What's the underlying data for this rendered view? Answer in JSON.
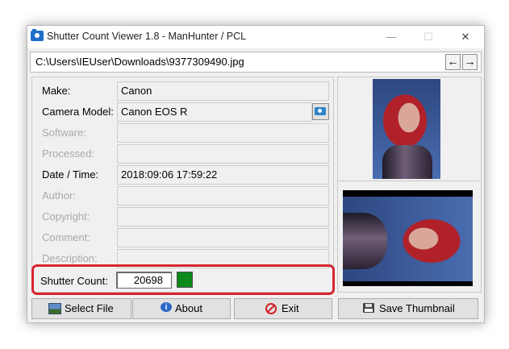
{
  "window": {
    "title": "Shutter Count Viewer 1.8 - ManHunter / PCL",
    "minimize_glyph": "—",
    "maximize_glyph": "☐",
    "close_glyph": "✕"
  },
  "file": {
    "path": "C:\\Users\\IEUser\\Downloads\\9377309490.jpg",
    "prev_glyph": "←",
    "next_glyph": "→"
  },
  "fields": [
    {
      "label": "Make:",
      "value": "Canon",
      "enabled": true
    },
    {
      "label": "Camera Model:",
      "value": "Canon EOS R",
      "enabled": true
    },
    {
      "label": "Software:",
      "value": "",
      "enabled": false
    },
    {
      "label": "Processed:",
      "value": "",
      "enabled": false
    },
    {
      "label": "Date / Time:",
      "value": "2018:09:06 17:59:22",
      "enabled": true
    },
    {
      "label": "Author:",
      "value": "",
      "enabled": false
    },
    {
      "label": "Copyright:",
      "value": "",
      "enabled": false
    },
    {
      "label": "Comment:",
      "value": "",
      "enabled": false
    },
    {
      "label": "Description:",
      "value": "",
      "enabled": false
    }
  ],
  "shutter": {
    "label": "Shutter Count:",
    "value": "20698",
    "indicator_color": "#0a8a1a"
  },
  "buttons": {
    "select_file": "Select File",
    "about": "About",
    "exit": "Exit",
    "save_thumbnail": "Save Thumbnail"
  },
  "icons": {
    "app": "camera-icon",
    "camera_model": "camera-icon",
    "select_file": "image-icon",
    "about": "info-icon",
    "exit": "stop-icon",
    "save": "floppy-disk-icon"
  },
  "colors": {
    "highlight": "#d7262f",
    "accent": "#1e6fc9"
  }
}
